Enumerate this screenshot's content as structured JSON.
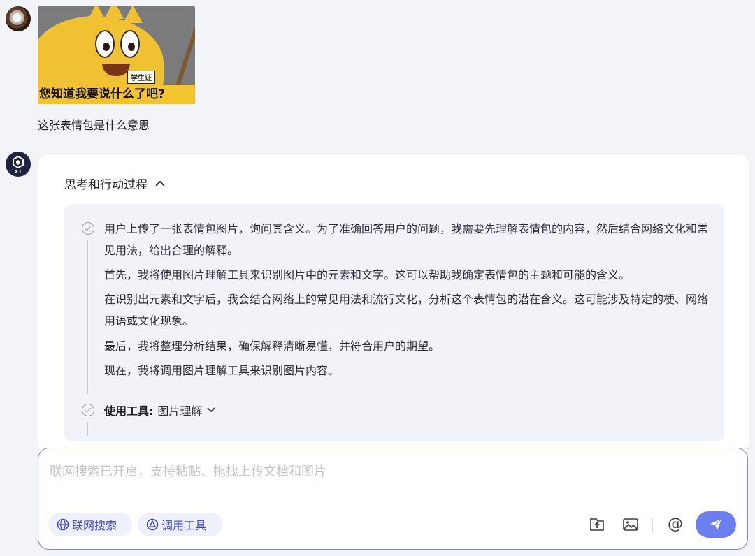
{
  "user": {
    "sticker": {
      "badge_text": "学生证",
      "caption": "您知道我要说什么了吧?"
    },
    "message": "这张表情包是什么意思"
  },
  "assistant": {
    "avatar_label": "X1",
    "thinking_header": "思考和行动过程",
    "thinking_paragraphs": [
      "用户上传了一张表情包图片，询问其含义。为了准确回答用户的问题，我需要先理解表情包的内容，然后结合网络文化和常见用法，给出合理的解释。",
      "首先，我将使用图片理解工具来识别图片中的元素和文字。这可以帮助我确定表情包的主题和可能的含义。",
      "在识别出元素和文字后，我会结合网络上的常见用法和流行文化，分析这个表情包的潜在含义。这可能涉及特定的梗、网络用语或文化现象。",
      "最后，我将整理分析结果，确保解释清晰易懂，并符合用户的期望。",
      "现在，我将调用图片理解工具来识别图片内容。"
    ],
    "tool_use": {
      "label": "使用工具:",
      "value": "图片理解"
    }
  },
  "input": {
    "placeholder": "联网搜索已开启，支持粘贴、拖拽上传文档和图片",
    "web_search_label": "联网搜索",
    "tools_label": "调用工具",
    "mention_symbol": "@"
  },
  "colors": {
    "accent": "#6b7ff0",
    "chip_text": "#3c4ad6",
    "background": "#f3f4f7",
    "panel": "#f2f3f8"
  },
  "icons": [
    "globe-icon",
    "tools-icon",
    "upload-icon",
    "image-icon",
    "at-icon",
    "send-icon",
    "chevron-up-icon",
    "chevron-down-icon",
    "check-circle-icon"
  ]
}
